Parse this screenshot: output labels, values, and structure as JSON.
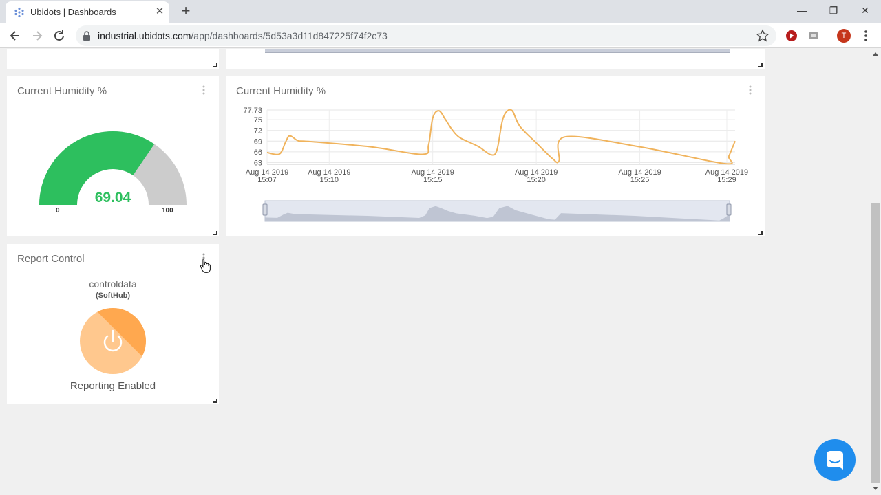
{
  "browser": {
    "tab_title": "Ubidots | Dashboards",
    "url_host": "industrial.ubidots.com",
    "url_path": "/app/dashboards/5d53a3d11d847225f74f2c73",
    "profile_initial": "T",
    "window_controls": {
      "minimize": "—",
      "restore": "❐",
      "close": "✕"
    }
  },
  "widgets": {
    "gauge": {
      "title": "Current Humidity %",
      "value": "69.04",
      "min": "0",
      "max": "100",
      "value_fraction": 0.6904,
      "color_fill": "#2dbf5e",
      "color_track": "#cccccc"
    },
    "line_chart": {
      "title": "Current Humidity %"
    },
    "report_control": {
      "title": "Report Control",
      "variable": "controldata",
      "device": "(SoftHub)",
      "status": "Reporting Enabled",
      "color_on": "#ffa84f",
      "color_on_light": "#ffc88e"
    }
  },
  "chart_data": {
    "type": "line",
    "title": "Current Humidity %",
    "y_ticks": [
      "77.73",
      "75",
      "72",
      "69",
      "66",
      "63"
    ],
    "ylim": [
      62.5,
      77.73
    ],
    "x_ticks": [
      {
        "date": "Aug 14 2019",
        "time": "15:07",
        "t": 0
      },
      {
        "date": "Aug 14 2019",
        "time": "15:10",
        "t": 3
      },
      {
        "date": "Aug 14 2019",
        "time": "15:15",
        "t": 8
      },
      {
        "date": "Aug 14 2019",
        "time": "15:20",
        "t": 13
      },
      {
        "date": "Aug 14 2019",
        "time": "15:25",
        "t": 18
      },
      {
        "date": "Aug 14 2019",
        "time": "15:29",
        "t": 22.2
      }
    ],
    "xlim": [
      0,
      22.6
    ],
    "series": [
      {
        "color": "#f0b35c",
        "t": [
          0,
          0.6,
          0.9,
          1.1,
          1.5,
          2,
          5,
          7.5,
          7.8,
          8.0,
          8.3,
          8.6,
          8.9,
          9.3,
          10.2,
          10.8,
          11.1,
          11.4,
          11.8,
          12.2,
          13.0,
          13.8,
          14.1,
          14.4,
          18,
          22.1,
          22.3,
          22.6
        ],
        "y": [
          65.8,
          65.4,
          68.8,
          70.5,
          69.1,
          68.9,
          67.4,
          65.3,
          68,
          75.5,
          77.5,
          75.2,
          72.5,
          70,
          67.5,
          65.2,
          66.5,
          75.5,
          77.7,
          73.2,
          68.5,
          64.0,
          63.5,
          70.2,
          67.4,
          62.7,
          64.8,
          69.0
        ]
      }
    ],
    "grid": true,
    "legend": "none",
    "range_selector": true
  }
}
